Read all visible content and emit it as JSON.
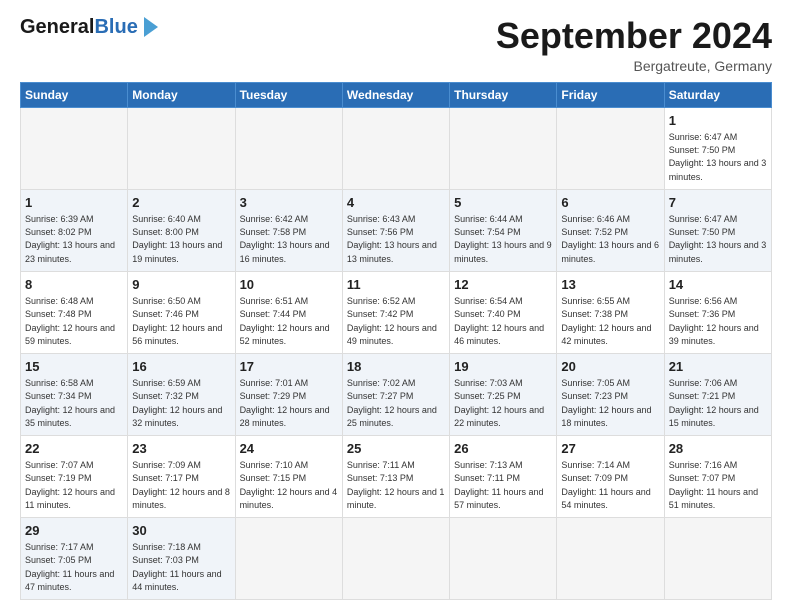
{
  "header": {
    "logo_general": "General",
    "logo_blue": "Blue",
    "month_title": "September 2024",
    "subtitle": "Bergatreute, Germany"
  },
  "calendar": {
    "headers": [
      "Sunday",
      "Monday",
      "Tuesday",
      "Wednesday",
      "Thursday",
      "Friday",
      "Saturday"
    ],
    "weeks": [
      [
        {
          "day": "",
          "empty": true
        },
        {
          "day": "",
          "empty": true
        },
        {
          "day": "",
          "empty": true
        },
        {
          "day": "",
          "empty": true
        },
        {
          "day": "",
          "empty": true
        },
        {
          "day": "",
          "empty": true
        },
        {
          "day": "1",
          "sunrise": "6:47 AM",
          "sunset": "7:50 PM",
          "daylight": "13 hours and 3 minutes."
        }
      ],
      [
        {
          "day": "1",
          "sunrise": "6:39 AM",
          "sunset": "8:02 PM",
          "daylight": "13 hours and 23 minutes."
        },
        {
          "day": "2",
          "sunrise": "6:40 AM",
          "sunset": "8:00 PM",
          "daylight": "13 hours and 19 minutes."
        },
        {
          "day": "3",
          "sunrise": "6:42 AM",
          "sunset": "7:58 PM",
          "daylight": "13 hours and 16 minutes."
        },
        {
          "day": "4",
          "sunrise": "6:43 AM",
          "sunset": "7:56 PM",
          "daylight": "13 hours and 13 minutes."
        },
        {
          "day": "5",
          "sunrise": "6:44 AM",
          "sunset": "7:54 PM",
          "daylight": "13 hours and 9 minutes."
        },
        {
          "day": "6",
          "sunrise": "6:46 AM",
          "sunset": "7:52 PM",
          "daylight": "13 hours and 6 minutes."
        },
        {
          "day": "7",
          "sunrise": "6:47 AM",
          "sunset": "7:50 PM",
          "daylight": "13 hours and 3 minutes."
        }
      ],
      [
        {
          "day": "8",
          "sunrise": "6:48 AM",
          "sunset": "7:48 PM",
          "daylight": "12 hours and 59 minutes."
        },
        {
          "day": "9",
          "sunrise": "6:50 AM",
          "sunset": "7:46 PM",
          "daylight": "12 hours and 56 minutes."
        },
        {
          "day": "10",
          "sunrise": "6:51 AM",
          "sunset": "7:44 PM",
          "daylight": "12 hours and 52 minutes."
        },
        {
          "day": "11",
          "sunrise": "6:52 AM",
          "sunset": "7:42 PM",
          "daylight": "12 hours and 49 minutes."
        },
        {
          "day": "12",
          "sunrise": "6:54 AM",
          "sunset": "7:40 PM",
          "daylight": "12 hours and 46 minutes."
        },
        {
          "day": "13",
          "sunrise": "6:55 AM",
          "sunset": "7:38 PM",
          "daylight": "12 hours and 42 minutes."
        },
        {
          "day": "14",
          "sunrise": "6:56 AM",
          "sunset": "7:36 PM",
          "daylight": "12 hours and 39 minutes."
        }
      ],
      [
        {
          "day": "15",
          "sunrise": "6:58 AM",
          "sunset": "7:34 PM",
          "daylight": "12 hours and 35 minutes."
        },
        {
          "day": "16",
          "sunrise": "6:59 AM",
          "sunset": "7:32 PM",
          "daylight": "12 hours and 32 minutes."
        },
        {
          "day": "17",
          "sunrise": "7:01 AM",
          "sunset": "7:29 PM",
          "daylight": "12 hours and 28 minutes."
        },
        {
          "day": "18",
          "sunrise": "7:02 AM",
          "sunset": "7:27 PM",
          "daylight": "12 hours and 25 minutes."
        },
        {
          "day": "19",
          "sunrise": "7:03 AM",
          "sunset": "7:25 PM",
          "daylight": "12 hours and 22 minutes."
        },
        {
          "day": "20",
          "sunrise": "7:05 AM",
          "sunset": "7:23 PM",
          "daylight": "12 hours and 18 minutes."
        },
        {
          "day": "21",
          "sunrise": "7:06 AM",
          "sunset": "7:21 PM",
          "daylight": "12 hours and 15 minutes."
        }
      ],
      [
        {
          "day": "22",
          "sunrise": "7:07 AM",
          "sunset": "7:19 PM",
          "daylight": "12 hours and 11 minutes."
        },
        {
          "day": "23",
          "sunrise": "7:09 AM",
          "sunset": "7:17 PM",
          "daylight": "12 hours and 8 minutes."
        },
        {
          "day": "24",
          "sunrise": "7:10 AM",
          "sunset": "7:15 PM",
          "daylight": "12 hours and 4 minutes."
        },
        {
          "day": "25",
          "sunrise": "7:11 AM",
          "sunset": "7:13 PM",
          "daylight": "12 hours and 1 minute."
        },
        {
          "day": "26",
          "sunrise": "7:13 AM",
          "sunset": "7:11 PM",
          "daylight": "11 hours and 57 minutes."
        },
        {
          "day": "27",
          "sunrise": "7:14 AM",
          "sunset": "7:09 PM",
          "daylight": "11 hours and 54 minutes."
        },
        {
          "day": "28",
          "sunrise": "7:16 AM",
          "sunset": "7:07 PM",
          "daylight": "11 hours and 51 minutes."
        }
      ],
      [
        {
          "day": "29",
          "sunrise": "7:17 AM",
          "sunset": "7:05 PM",
          "daylight": "11 hours and 47 minutes."
        },
        {
          "day": "30",
          "sunrise": "7:18 AM",
          "sunset": "7:03 PM",
          "daylight": "11 hours and 44 minutes."
        },
        {
          "day": "",
          "empty": true
        },
        {
          "day": "",
          "empty": true
        },
        {
          "day": "",
          "empty": true
        },
        {
          "day": "",
          "empty": true
        },
        {
          "day": "",
          "empty": true
        }
      ]
    ]
  }
}
